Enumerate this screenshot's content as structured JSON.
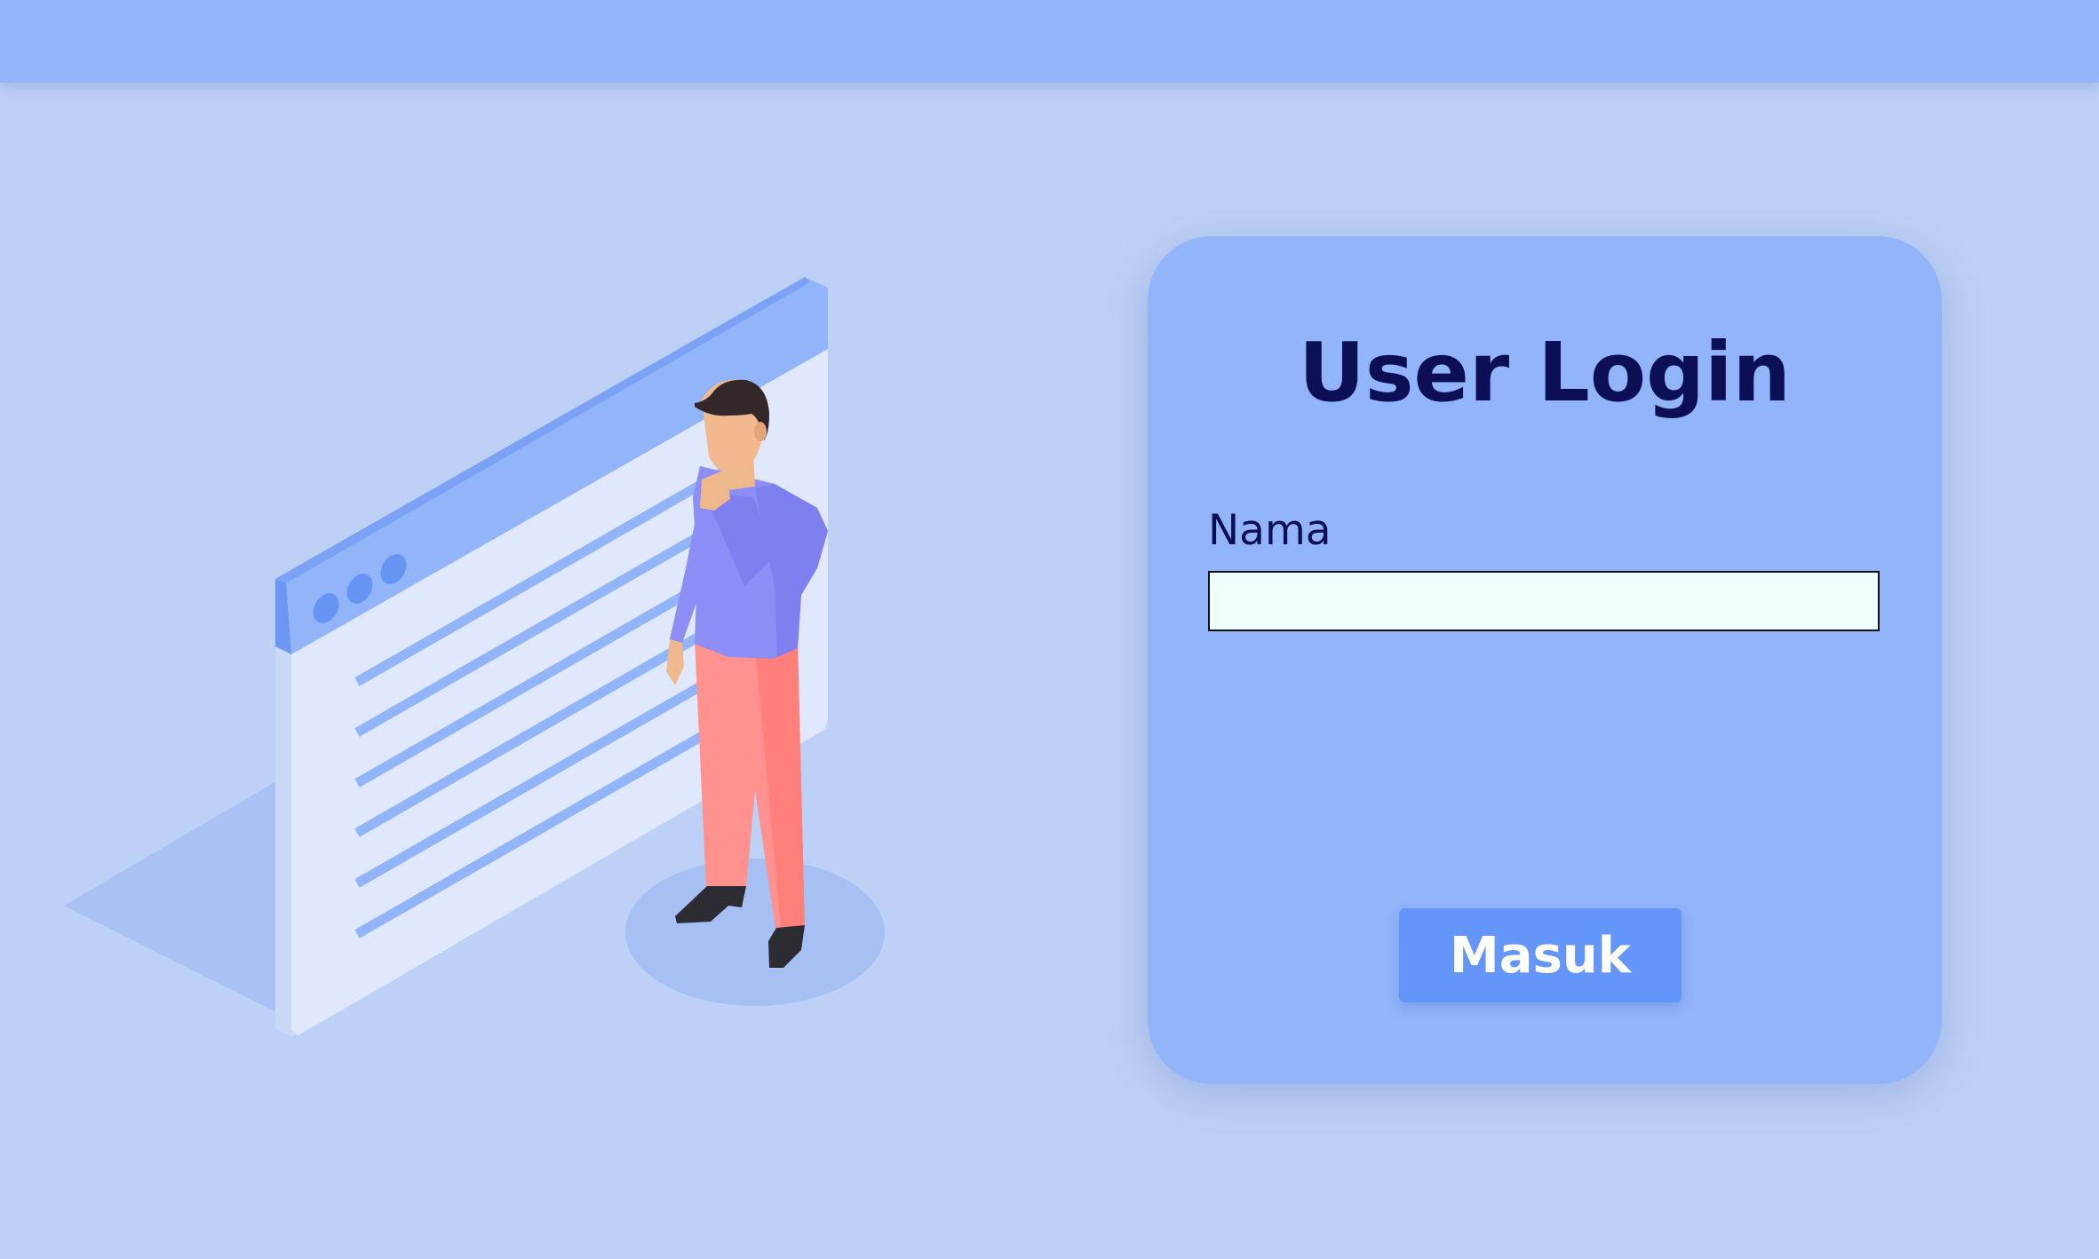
{
  "page": {
    "background_color": "#bdd0f6",
    "topbar_color": "#92b4f9"
  },
  "login": {
    "title": "User Login",
    "name_label": "Nama",
    "name_value": "",
    "submit_label": "Masuk",
    "card_color": "#92b4f9",
    "title_color": "#0d0f56",
    "input_bg_color": "#eefffc",
    "button_color": "#6495f8"
  },
  "illustration": {
    "icon": "browser-window-with-person-illustration",
    "window_dots": 3,
    "content_lines": 6
  }
}
